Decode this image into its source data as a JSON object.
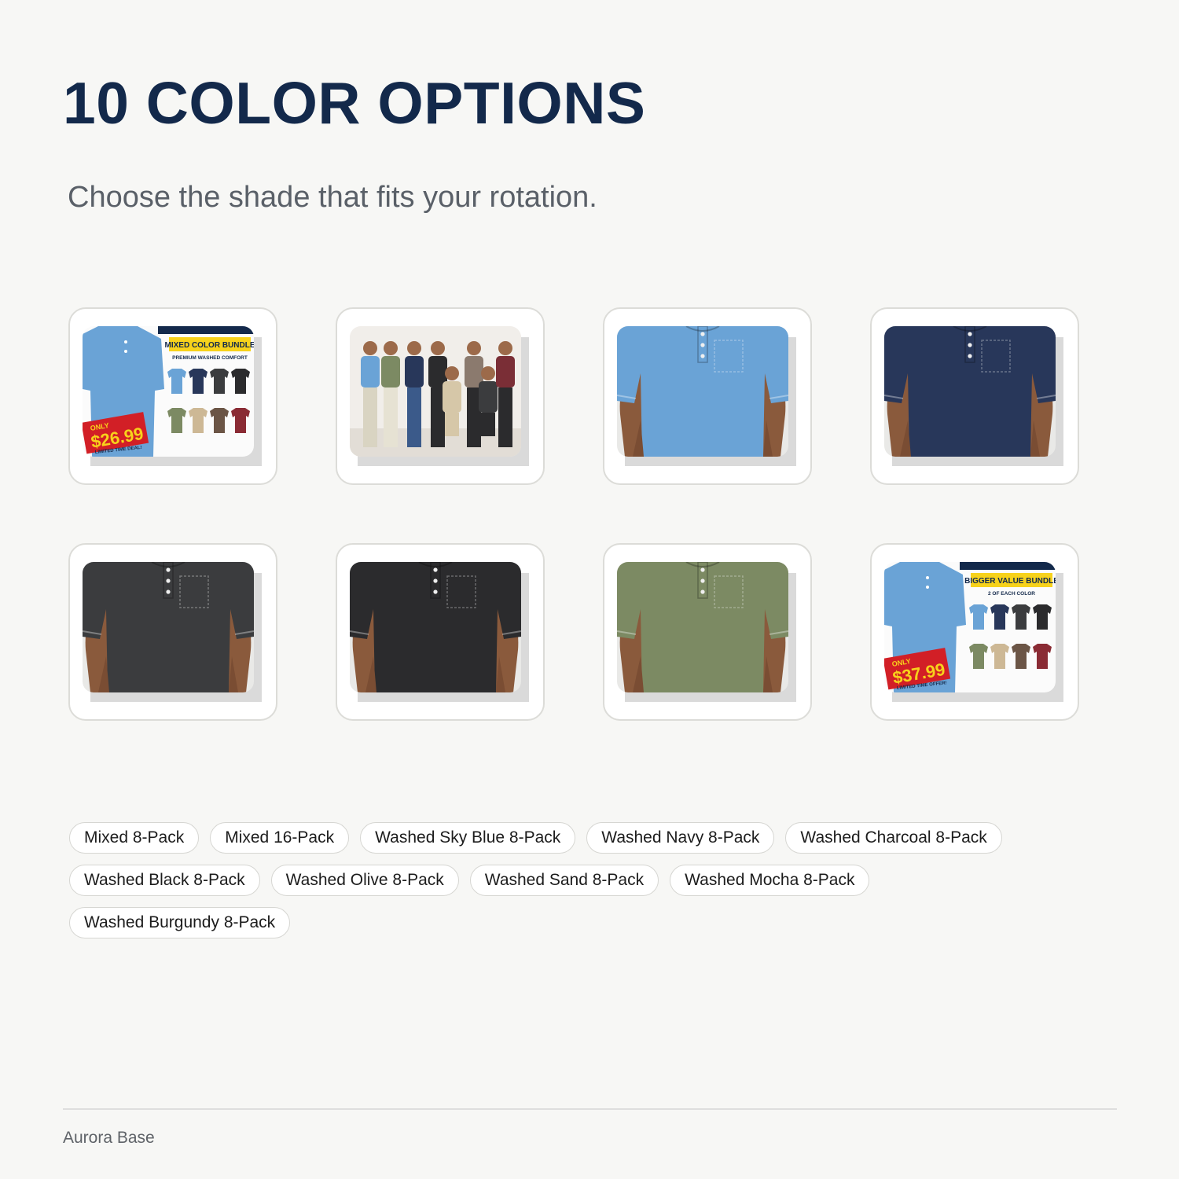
{
  "heading": "10 COLOR OPTIONS",
  "subheading": "Choose the shade that fits your rotation.",
  "thumbnails": [
    {
      "kind": "bundle-mixed",
      "banner": "MIXED COLOR BUNDLE",
      "tagline": "PREMIUM WASHED COMFORT",
      "price_label": "ONLY",
      "price": "$26.99",
      "deal": "LIMITED TIME DEAL!"
    },
    {
      "kind": "group-photo"
    },
    {
      "kind": "shirt",
      "color": "#6aa3d6"
    },
    {
      "kind": "shirt",
      "color": "#28375a"
    },
    {
      "kind": "shirt",
      "color": "#3b3c3e"
    },
    {
      "kind": "shirt",
      "color": "#2b2b2d"
    },
    {
      "kind": "shirt",
      "color": "#7c8a63"
    },
    {
      "kind": "bundle-16",
      "banner": "BIGGER VALUE BUNDLE",
      "tagline": "2 OF EACH COLOR",
      "price_label": "ONLY",
      "price": "$37.99",
      "deal": "LIMITED TIME OFFER!"
    }
  ],
  "colors_meta": {
    "accent": "#13294b",
    "sale_red": "#d21f26",
    "price_yellow": "#f7d21b"
  },
  "options": [
    "Mixed 8-Pack",
    "Mixed 16-Pack",
    "Washed Sky Blue 8-Pack",
    "Washed Navy 8-Pack",
    "Washed Charcoal 8-Pack",
    "Washed Black 8-Pack",
    "Washed Olive 8-Pack",
    "Washed Sand 8-Pack",
    "Washed Mocha 8-Pack",
    "Washed Burgundy 8-Pack"
  ],
  "footer": "Aurora Base"
}
